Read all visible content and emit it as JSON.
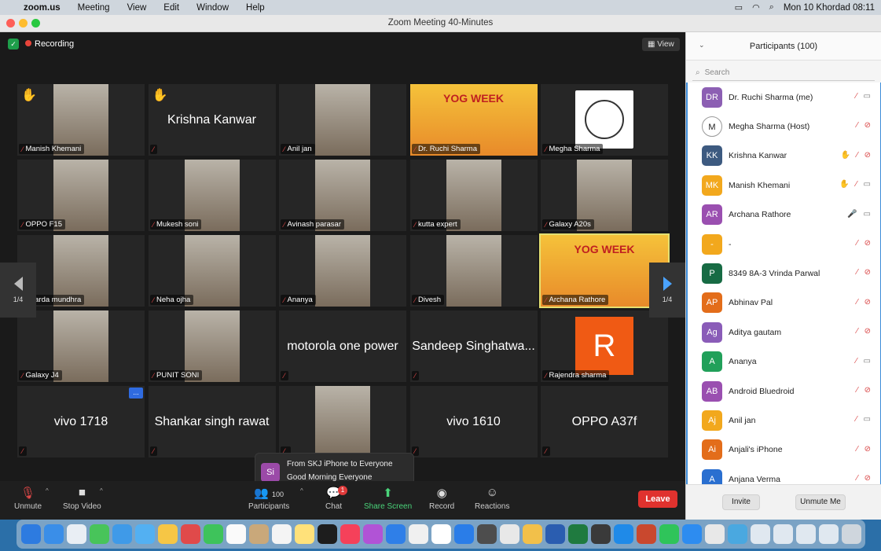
{
  "menubar": {
    "app": "zoom.us",
    "items": [
      "Meeting",
      "View",
      "Edit",
      "Window",
      "Help"
    ],
    "clock": "Mon 10 Khordad  08:11"
  },
  "window": {
    "title": "Zoom Meeting   40-Minutes"
  },
  "meeting": {
    "recording_label": "Recording",
    "view_label": "View",
    "page_indicator": "1/4",
    "tiles": [
      {
        "name": "Manish Khemani",
        "type": "video",
        "hand": true
      },
      {
        "name": "Krishna Kanwar",
        "type": "name",
        "hand": true
      },
      {
        "name": "Anil jan",
        "type": "video"
      },
      {
        "name": "Dr. Ruchi Sharma",
        "type": "video",
        "banner": "YOG WEEK"
      },
      {
        "name": "Megha Sharma",
        "type": "logo"
      },
      {
        "name": "OPPO F15",
        "type": "video"
      },
      {
        "name": "Mukesh soni",
        "type": "video"
      },
      {
        "name": "Avinash parasar",
        "type": "video"
      },
      {
        "name": "kutta expert",
        "type": "video"
      },
      {
        "name": "Galaxy A20s",
        "type": "video"
      },
      {
        "name": "Sharda mundhra",
        "type": "video"
      },
      {
        "name": "Neha ojha",
        "type": "video"
      },
      {
        "name": "Ananya",
        "type": "video"
      },
      {
        "name": "Divesh",
        "type": "video"
      },
      {
        "name": "Archana Rathore",
        "type": "video",
        "active": true,
        "banner": "YOG WEEK"
      },
      {
        "name": "Galaxy J4",
        "type": "video"
      },
      {
        "name": "PUNIT SONI",
        "type": "video"
      },
      {
        "name": "motorola one power",
        "type": "name"
      },
      {
        "name": "Sandeep Singhatwa...",
        "type": "name"
      },
      {
        "name": "Rajendra sharma",
        "type": "avatar",
        "letter": "R"
      },
      {
        "name": "vivo 1718",
        "type": "name",
        "more": "..."
      },
      {
        "name": "Shankar singh rawat",
        "type": "name"
      },
      {
        "name": "",
        "type": "video"
      },
      {
        "name": "vivo 1610",
        "type": "name"
      },
      {
        "name": "OPPO A37f",
        "type": "name"
      }
    ],
    "chat_toast": {
      "avatar": "Si",
      "from": "From SKJ iPhone to Everyone",
      "message": "Good Morning Everyone"
    }
  },
  "toolbar": {
    "unmute": "Unmute",
    "stop_video": "Stop Video",
    "participants": "Participants",
    "participants_count": "100",
    "chat": "Chat",
    "chat_badge": "1",
    "share_screen": "Share Screen",
    "record": "Record",
    "reactions": "Reactions",
    "leave": "Leave"
  },
  "panel": {
    "title": "Participants (100)",
    "search_placeholder": "Search",
    "participants": [
      {
        "initials": "DR",
        "name": "Dr. Ruchi Sharma (me)",
        "color": "#8c5fb3",
        "mic": "off",
        "cam": "on"
      },
      {
        "initials": "M",
        "name": "Megha Sharma (Host)",
        "color": "#ffffff",
        "mic": "off",
        "cam": "off"
      },
      {
        "initials": "KK",
        "name": "Krishna Kanwar",
        "color": "#3d5a80",
        "mic": "off",
        "cam": "off",
        "hand": true
      },
      {
        "initials": "MK",
        "name": "Manish Khemani",
        "color": "#f2a81d",
        "mic": "off",
        "cam": "on",
        "hand": true
      },
      {
        "initials": "AR",
        "name": "Archana Rathore",
        "color": "#9a4fb0",
        "mic": "on",
        "cam": "on"
      },
      {
        "initials": "-",
        "name": "-",
        "color": "#f2a81d",
        "mic": "off",
        "cam": "off"
      },
      {
        "initials": "P",
        "name": "8349 8A-3 Vrinda Parwal",
        "color": "#176b44",
        "mic": "off",
        "cam": "off"
      },
      {
        "initials": "AP",
        "name": "Abhinav Pal",
        "color": "#e36d1a",
        "mic": "off",
        "cam": "off"
      },
      {
        "initials": "Ag",
        "name": "Aditya gautam",
        "color": "#8a5cb8",
        "mic": "off",
        "cam": "off"
      },
      {
        "initials": "A",
        "name": "Ananya",
        "color": "#21a05a",
        "mic": "off",
        "cam": "on"
      },
      {
        "initials": "AB",
        "name": "Android Bluedroid",
        "color": "#9a4fb0",
        "mic": "off",
        "cam": "off"
      },
      {
        "initials": "Aj",
        "name": "Anil jan",
        "color": "#f2a81d",
        "mic": "off",
        "cam": "on"
      },
      {
        "initials": "Ai",
        "name": "Anjali's iPhone",
        "color": "#e36d1a",
        "mic": "off",
        "cam": "off"
      },
      {
        "initials": "A",
        "name": "Anjana Verma",
        "color": "#2a6fd0",
        "mic": "off",
        "cam": "off"
      }
    ],
    "invite": "Invite",
    "unmute_me": "Unmute Me"
  },
  "dock_colors": [
    "#2d7be0",
    "#3a8ee8",
    "#e9eef4",
    "#48c45a",
    "#3f9ae8",
    "#53b0f2",
    "#f6c645",
    "#e04a4a",
    "#3ec35b",
    "#fafafa",
    "#c9a87a",
    "#f4f4f4",
    "#ffe17a",
    "#1d1d1d",
    "#f5415a",
    "#b153d6",
    "#2f7fe8",
    "#f0f0f0",
    "#ffffff",
    "#2a7de8",
    "#4d4d4d",
    "#e8e8e8",
    "#f2c04a",
    "#2a5db0",
    "#1f7a3f",
    "#3a3a3a",
    "#1f8ae8",
    "#c9482e",
    "#2fc45a",
    "#2d8cf0",
    "#e8e8e8",
    "#4aa8e0",
    "#e0e8f0",
    "#e0e8f0",
    "#e0e8f0",
    "#e0e8f0",
    "#cfd6dd"
  ]
}
